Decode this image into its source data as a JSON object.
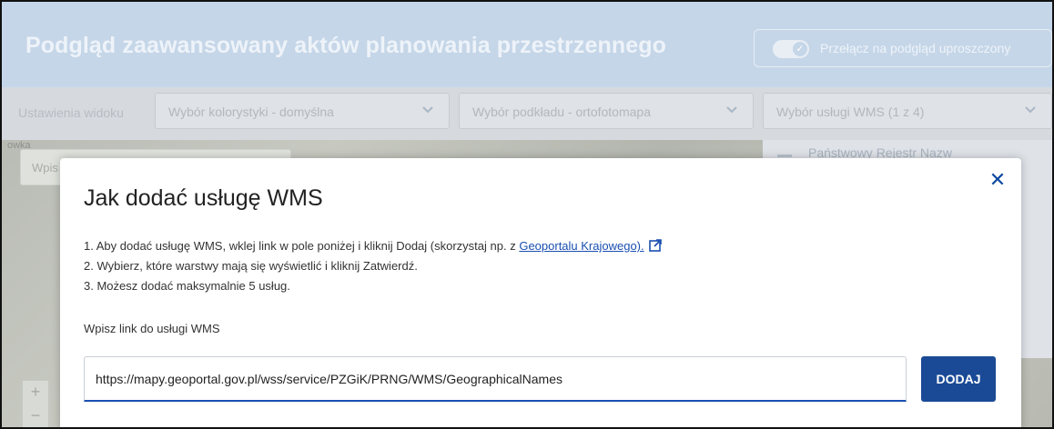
{
  "header": {
    "title": "Podgląd zaawansowany aktów planowania przestrzennego",
    "toggle_label": "Przełącz na podgląd uproszczony"
  },
  "toolbar": {
    "label": "Ustawienia widoku",
    "color_select": "Wybór kolorystyki - domyślna",
    "basemap_select": "Wybór podkładu - ortofotomapa",
    "wms_select": "Wybór usługi WMS (1 z 4)"
  },
  "map": {
    "corner_label": "owka",
    "search_placeholder": "Wpis",
    "layer_item": "Państwowy Rejestr Nazw",
    "zoom_in": "+",
    "zoom_out": "−"
  },
  "modal": {
    "title": "Jak dodać usługę WMS",
    "step1_text": "1. Aby dodać usługę WMS, wklej link w pole poniżej i kliknij Dodaj (skorzystaj np. z ",
    "step1_link": "Geoportalu Krajowego).",
    "step2": "2. Wybierz, które warstwy mają się wyświetlić i kliknij Zatwierdź.",
    "step3": "3. Możesz dodać maksymalnie 5 usług.",
    "field_label": "Wpisz link do usługi WMS",
    "input_value": "https://mapy.geoportal.gov.pl/wss/service/PZGiK/PRNG/WMS/GeographicalNames",
    "add_button": "DODAJ",
    "close_symbol": "✕"
  },
  "colors": {
    "accent": "#1a4a96",
    "link": "#1a4fb0",
    "header_bg": "#c5d6e8"
  }
}
